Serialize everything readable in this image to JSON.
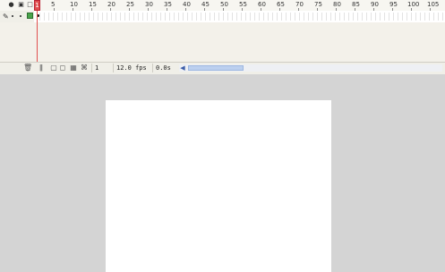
{
  "timeline": {
    "ruler": {
      "labels": [
        "1",
        "5",
        "10",
        "15",
        "20",
        "25",
        "30",
        "35",
        "40",
        "45",
        "50",
        "55",
        "60",
        "65",
        "70",
        "75",
        "80",
        "85",
        "90",
        "95",
        "100",
        "105"
      ]
    },
    "status": {
      "current_frame": "1",
      "frame_rate": "12.0 fps",
      "elapsed_time": "0.0s"
    }
  }
}
